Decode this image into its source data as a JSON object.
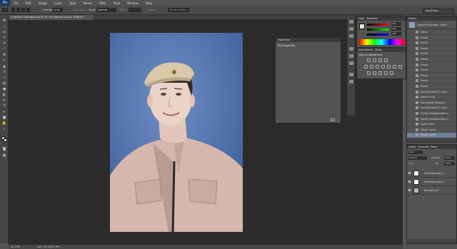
{
  "app": {
    "logo": "Ps",
    "workspace": "Essentials"
  },
  "menu": [
    "File",
    "Edit",
    "Image",
    "Layer",
    "Type",
    "Select",
    "Filter",
    "View",
    "Window",
    "Help"
  ],
  "options": {
    "feather_label": "Feather:",
    "feather_value": "0 px",
    "antialias": "Anti-alias",
    "style_label": "Style:",
    "style_value": "Normal",
    "width_label": "Width:",
    "height_label": "Height:",
    "refine": "Refine Edge..."
  },
  "document": {
    "tab_title": "Colorized Grandpa.psd @ 24.2% (Merge Layers, RGB/8) *",
    "zoom": "24.25%",
    "doc_size": "Doc: 25.9M/92.9M"
  },
  "properties": {
    "tab": "Properties",
    "message": "No Properties"
  },
  "color_panel": {
    "tabs": [
      "Color",
      "Swatches"
    ],
    "values": [
      "202",
      "182",
      "165"
    ]
  },
  "adjust_panel": {
    "tabs": [
      "Adjustments",
      "Styles"
    ],
    "title": "Add an adjustment"
  },
  "history": {
    "tab": "History",
    "snapshot": "Colorized Grandpa - Fixed ...",
    "items": [
      "Eraser",
      "Eraser",
      "Eraser",
      "Eraser",
      "Eraser",
      "Eraser",
      "Eraser",
      "Eraser",
      "Eraser",
      "Eraser",
      "Eraser",
      "Hue/Saturation 2 Layer",
      "Delete Layer",
      "Rectangular Marquee",
      "Hue/Saturation 2 Layer",
      "Modify Hue/Saturation L...",
      "Modify Hue/Saturation L...",
      "Layer Order",
      "Merge Layers",
      "Merge Layers"
    ]
  },
  "layers": {
    "tabs": [
      "Layers",
      "Channels",
      "Paths"
    ],
    "kind": "Kind",
    "blend": "Normal",
    "opacity_label": "Opacity:",
    "opacity": "100%",
    "lock_label": "Lock:",
    "fill_label": "Fill:",
    "fill": "100%",
    "items": [
      "Hue/Saturation 1",
      "Hue/Saturation 2",
      "Background"
    ]
  },
  "colors": {
    "accent_blue": "#4a6ca8",
    "panel_bg": "#535353",
    "canvas_bg": "#2b2b2b"
  }
}
